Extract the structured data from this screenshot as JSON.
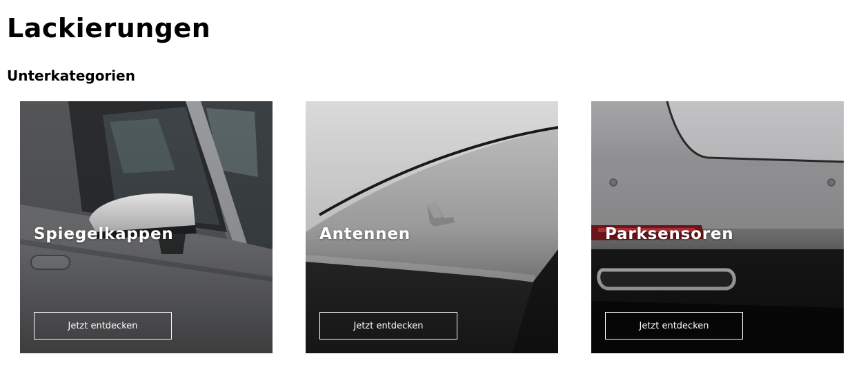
{
  "page": {
    "title": "Lackierungen",
    "subcategories_heading": "Unterkategorien"
  },
  "cards": [
    {
      "title": "Spiegelkappen",
      "button_label": "Jetzt entdecken",
      "image": "car-side-mirror-photo"
    },
    {
      "title": "Antennen",
      "button_label": "Jetzt entdecken",
      "image": "car-roof-antenna-photo"
    },
    {
      "title": "Parksensoren",
      "button_label": "Jetzt entdecken",
      "image": "car-rear-bumper-sensors-photo"
    }
  ],
  "colors": {
    "text": "#000000",
    "card_text": "#ffffff",
    "background": "#ffffff"
  }
}
